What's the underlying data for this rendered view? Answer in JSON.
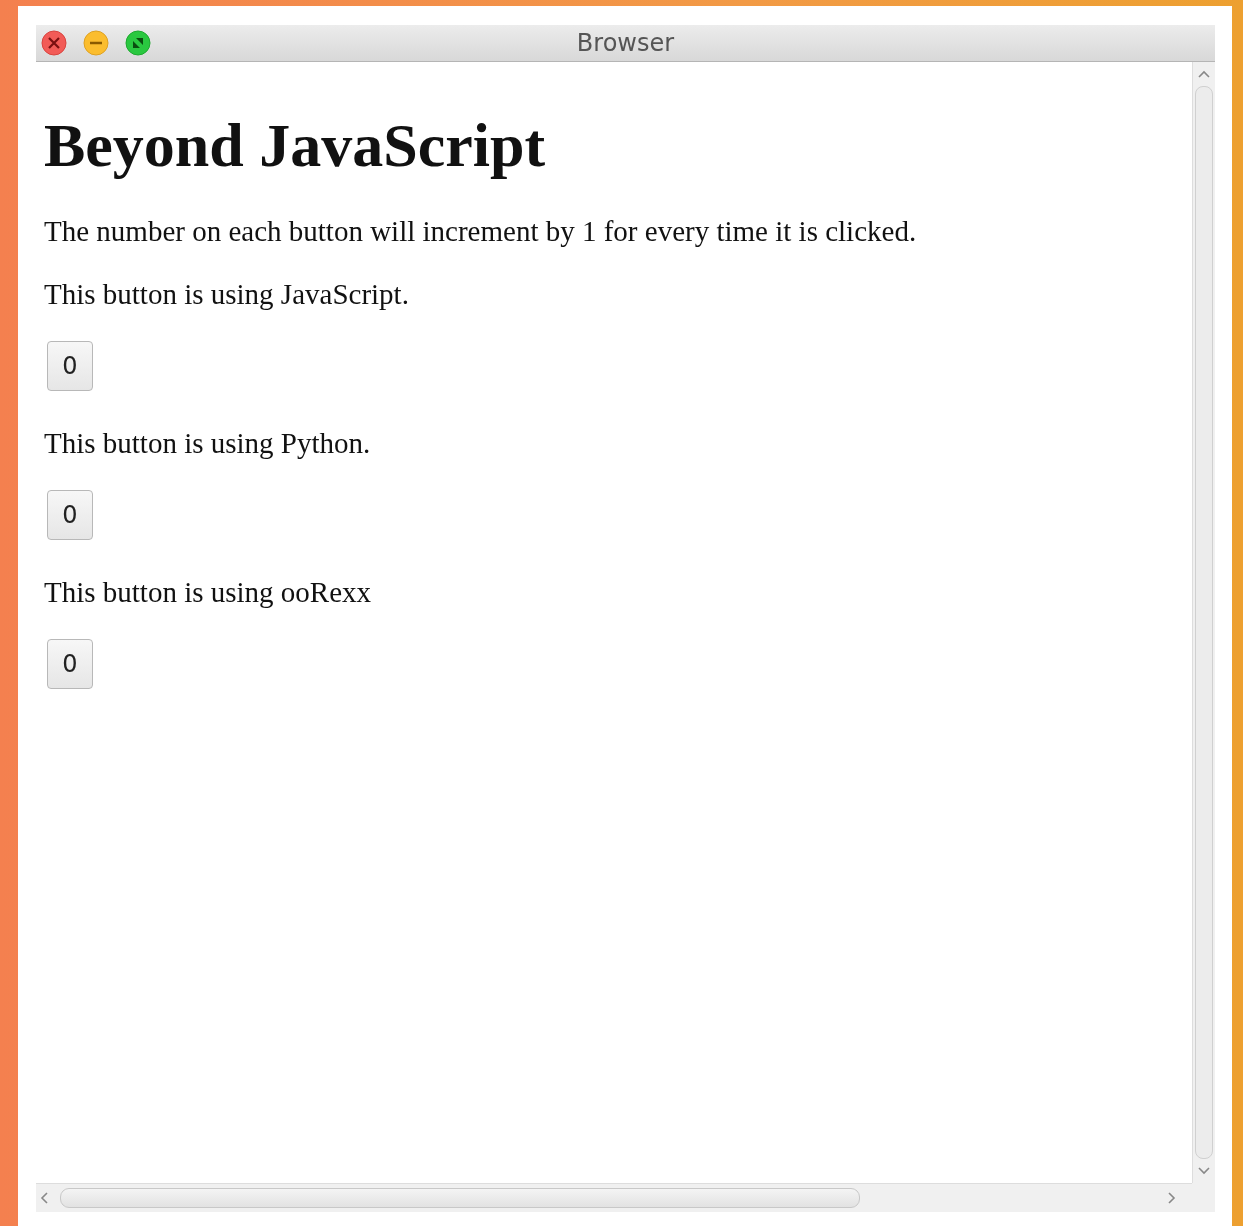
{
  "window": {
    "title": "Browser"
  },
  "heading": "Beyond JavaScript",
  "intro": "The number on each button will increment by 1 for every time it is clicked.",
  "sections": [
    {
      "label": "This button is using JavaScript.",
      "button": "0"
    },
    {
      "label": "This button is using Python.",
      "button": "0"
    },
    {
      "label": "This button is using ooRexx",
      "button": "0"
    }
  ]
}
